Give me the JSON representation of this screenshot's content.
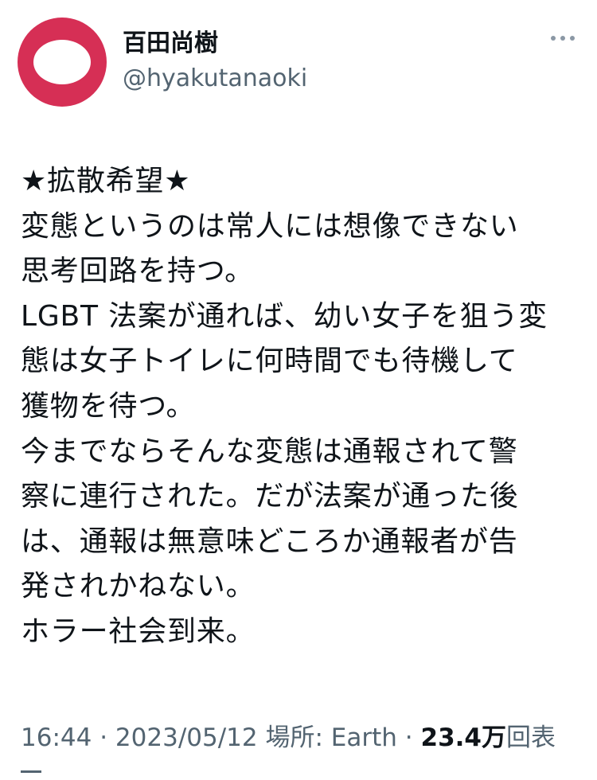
{
  "author": {
    "display_name": "百田尚樹",
    "handle": "@hyakutanaoki",
    "avatar_colors": {
      "outer": "#d62f55",
      "inner": "#ffffff"
    }
  },
  "more_icon": "more-horizontal-icon",
  "tweet": {
    "lines": [
      "★拡散希望★",
      "変態というのは常人には想像できない",
      "思考回路を持つ。",
      "LGBT 法案が通れば、幼い女子を狙う変",
      "態は女子トイレに何時間でも待機して",
      "獲物を待つ。",
      "今までならそんな変態は通報されて警",
      "察に連行された。だが法案が通った後",
      "は、通報は無意味どころか通報者が告",
      "発されかねない。",
      "ホラー社会到来。"
    ]
  },
  "meta": {
    "time": "16:44",
    "separator": "·",
    "date": "2023/05/12",
    "location_label": "場所:",
    "location": "Earth",
    "views_count": "23.4万",
    "views_label": "回表"
  },
  "colors": {
    "text_primary": "#0f1419",
    "text_secondary": "#536471",
    "background": "#ffffff"
  }
}
